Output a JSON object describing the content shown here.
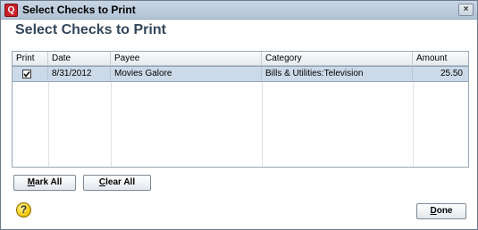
{
  "window": {
    "title": "Select Checks to Print",
    "app_icon": "Q",
    "close_glyph": "×"
  },
  "heading": "Select Checks to Print",
  "grid": {
    "columns": [
      "Print",
      "Date",
      "Payee",
      "Category",
      "Amount"
    ],
    "rows": [
      {
        "print_checked": true,
        "date": "8/31/2012",
        "payee": "Movies Galore",
        "category": "Bills & Utilities:Television",
        "amount": "25.50"
      }
    ]
  },
  "buttons": {
    "mark_all": "Mark All",
    "mark_all_mnemonic": "M",
    "mark_all_rest": "ark All",
    "clear_all": "Clear All",
    "clear_all_mnemonic": "C",
    "clear_all_rest": "lear All",
    "done": "Done",
    "done_mnemonic": "D",
    "done_rest": "one"
  },
  "help": {
    "glyph": "?",
    "icon": "help-icon"
  },
  "colors": {
    "selected_row": "#ccd9e8",
    "heading": "#33475b",
    "titlebar": "#b2c3d6"
  }
}
